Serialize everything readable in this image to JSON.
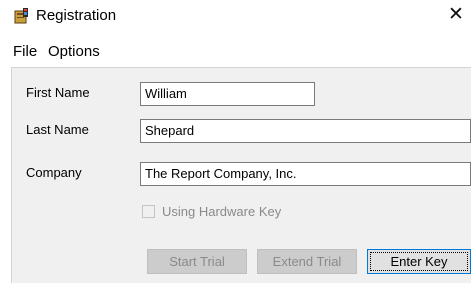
{
  "window": {
    "title": "Registration",
    "icon": "registration-app-icon",
    "close_glyph": "✕"
  },
  "menu": {
    "items": [
      {
        "label": "File"
      },
      {
        "label": "Options"
      }
    ]
  },
  "form": {
    "first_name": {
      "label": "First Name",
      "value": "William"
    },
    "last_name": {
      "label": "Last Name",
      "value": "Shepard"
    },
    "company": {
      "label": "Company",
      "value": "The Report Company, Inc."
    },
    "hardware_key": {
      "label": "Using Hardware Key",
      "checked": false,
      "enabled": false
    }
  },
  "buttons": {
    "start_trial": {
      "label": "Start Trial",
      "enabled": false
    },
    "extend_trial": {
      "label": "Extend Trial",
      "enabled": false
    },
    "enter_key": {
      "label": "Enter Key",
      "enabled": true,
      "focused": true
    }
  },
  "colors": {
    "dialog_background": "#f0f0f0",
    "focus_border": "#0078d7",
    "disabled_text": "#8a8a8a"
  }
}
